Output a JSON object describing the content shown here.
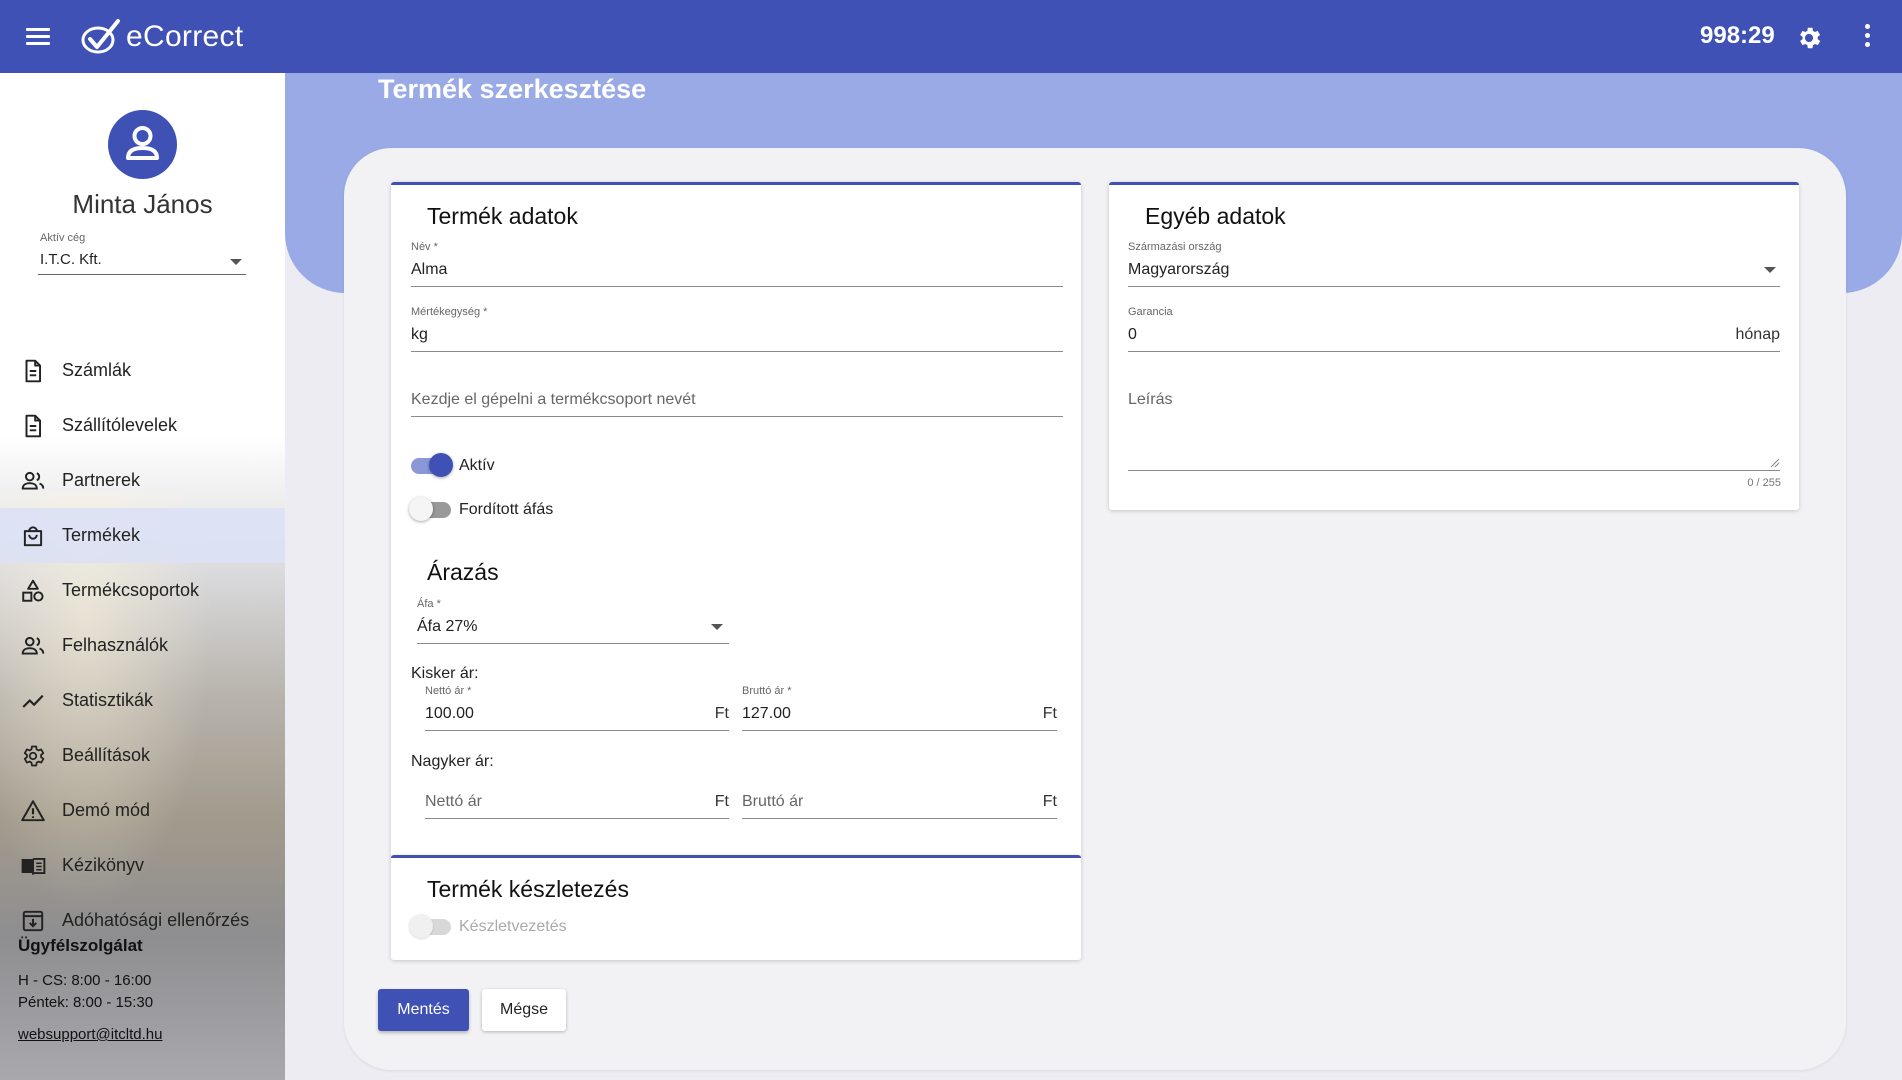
{
  "app": {
    "title": "eCorrect",
    "timer": "998:29"
  },
  "user": {
    "name": "Minta János",
    "company_label": "Aktív cég",
    "company": "I.T.C. Kft."
  },
  "nav": [
    {
      "label": "Számlák",
      "icon": "document-icon"
    },
    {
      "label": "Szállítólevelek",
      "icon": "document-icon"
    },
    {
      "label": "Partnerek",
      "icon": "people-icon"
    },
    {
      "label": "Termékek",
      "icon": "shopping-bag-icon"
    },
    {
      "label": "Termékcsoportok",
      "icon": "category-icon"
    },
    {
      "label": "Felhasználók",
      "icon": "people-icon"
    },
    {
      "label": "Statisztikák",
      "icon": "trend-icon"
    },
    {
      "label": "Beállítások",
      "icon": "gear-icon"
    },
    {
      "label": "Demó mód",
      "icon": "warning-icon"
    },
    {
      "label": "Kézikönyv",
      "icon": "book-icon"
    },
    {
      "label": "Adóhatósági ellenőrzés",
      "icon": "archive-download-icon"
    }
  ],
  "support": {
    "title": "Ügyfélszolgálat",
    "hours1": "H - CS: 8:00 - 16:00",
    "hours2": "Péntek: 8:00 - 15:30",
    "email": "websupport@itcltd.hu"
  },
  "page": {
    "title": "Termék szerkesztése"
  },
  "product": {
    "title": "Termék adatok",
    "name_label": "Név *",
    "name_value": "Alma",
    "unit_label": "Mértékegység *",
    "unit_value": "kg",
    "group_placeholder": "Kezdje el gépelni a termékcsoport nevét",
    "active_label": "Aktív",
    "reverse_vat_label": "Fordított áfás"
  },
  "pricing": {
    "title": "Árazás",
    "vat_label": "Áfa *",
    "vat_value": "Áfa 27%",
    "retail_label": "Kisker ár:",
    "retail_net_label": "Nettó ár *",
    "retail_net_value": "100.00",
    "retail_gross_label": "Bruttó ár *",
    "retail_gross_value": "127.00",
    "currency": "Ft",
    "wholesale_label": "Nagyker ár:",
    "wholesale_net_placeholder": "Nettó ár",
    "wholesale_gross_placeholder": "Bruttó ár"
  },
  "stock": {
    "title": "Termék készletezés",
    "toggle_label": "Készletvezetés"
  },
  "other": {
    "title": "Egyéb adatok",
    "country_label": "Származási ország",
    "country_value": "Magyarország",
    "warranty_label": "Garancia",
    "warranty_value": "0",
    "warranty_unit": "hónap",
    "description_placeholder": "Leírás",
    "description_counter": "0 / 255"
  },
  "actions": {
    "save": "Mentés",
    "cancel": "Mégse"
  },
  "colors": {
    "primary": "#3f51b5",
    "band": "#99aae6"
  }
}
